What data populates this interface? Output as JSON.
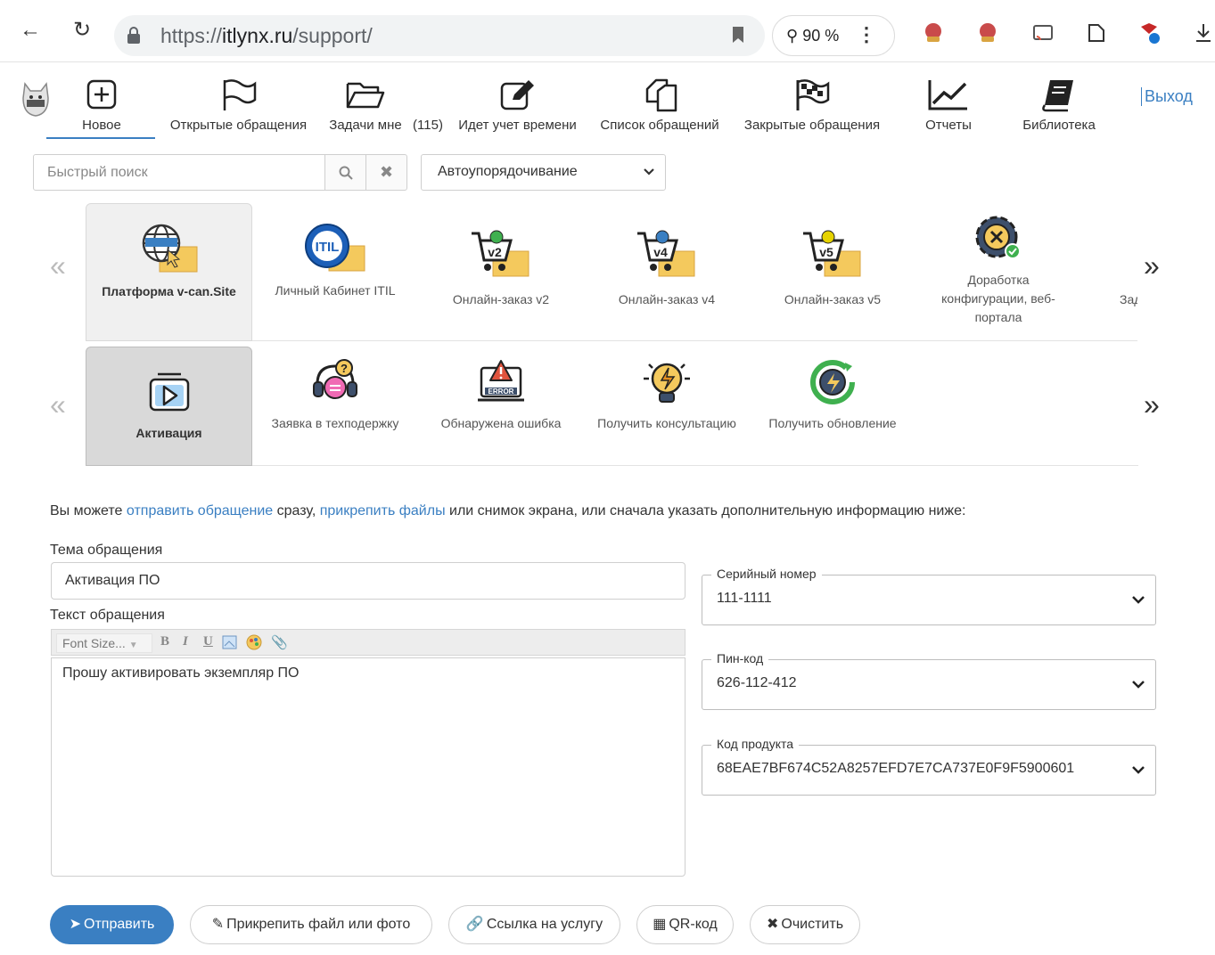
{
  "browser": {
    "url_prefix": "https://",
    "url_domain": "itlynx.ru",
    "url_path": "/support/",
    "zoom": "90 %"
  },
  "nav": {
    "items": [
      {
        "label": "Новое",
        "icon": "plus-square-icon"
      },
      {
        "label": "Открытые обращения",
        "icon": "flag-outline-icon"
      },
      {
        "label": "Задачи мне",
        "icon": "folder-open-icon"
      },
      {
        "label": "(115)",
        "icon": ""
      },
      {
        "label": "Идет учет времени",
        "icon": "edit-square-icon"
      },
      {
        "label": "Список обращений",
        "icon": "copy-icon"
      },
      {
        "label": "Закрытые обращения",
        "icon": "checkered-flag-icon"
      },
      {
        "label": "Отчеты",
        "icon": "chart-line-icon"
      },
      {
        "label": "Библиотека",
        "icon": "book-icon"
      }
    ],
    "logout": "Выход"
  },
  "search": {
    "placeholder": "Быстрый поиск",
    "sort_value": "Автоупорядочивание"
  },
  "products": [
    {
      "label": "Платформа v-can.Site",
      "icon": "globe-folder-icon"
    },
    {
      "label": "Личный Кабинет ITIL",
      "icon": "itil-folder-icon"
    },
    {
      "label": "Онлайн-заказ v2",
      "icon": "cart-v2-icon"
    },
    {
      "label": "Онлайн-заказ v4",
      "icon": "cart-v4-icon"
    },
    {
      "label": "Онлайн-заказ v5",
      "icon": "cart-v5-icon"
    },
    {
      "label": "Доработка конфигурации, веб-портала",
      "icon": "gear-wrench-icon"
    },
    {
      "label": "Зад",
      "icon": ""
    }
  ],
  "request_types": [
    {
      "label": "Активация",
      "icon": "play-box-icon"
    },
    {
      "label": "Заявка в техподержку",
      "icon": "headset-icon"
    },
    {
      "label": "Обнаружена ошибка",
      "icon": "error-laptop-icon"
    },
    {
      "label": "Получить консультацию",
      "icon": "lightbulb-icon"
    },
    {
      "label": "Получить обновление",
      "icon": "refresh-bolt-icon"
    }
  ],
  "info": {
    "part1": "Вы можете ",
    "link1": "отправить обращение",
    "part2": " сразу, ",
    "link2": "прикрепить файлы",
    "part3": " или снимок экрана, или сначала указать дополнительную информацию ниже:"
  },
  "form": {
    "subject_label": "Тема обращения",
    "subject_value": "Активация ПО",
    "text_label": "Текст обращения",
    "font_size_placeholder": "Font Size...",
    "text_value": "Прошу активировать экземпляр ПО",
    "serial_label": "Серийный номер",
    "serial_value": "111-1111",
    "pin_label": "Пин-код",
    "pin_value": "626-112-412",
    "product_code_label": "Код продукта",
    "product_code_value": "68EAE7BF674C52A8257EFD7E7CA737E0F9F5900601"
  },
  "buttons": {
    "send": "Отправить",
    "attach": "Прикрепить файл или фото",
    "link": "Ссылка на услугу",
    "qr": "QR-код",
    "clear": "Очистить"
  },
  "colors": {
    "accent": "#3a7fc2"
  }
}
